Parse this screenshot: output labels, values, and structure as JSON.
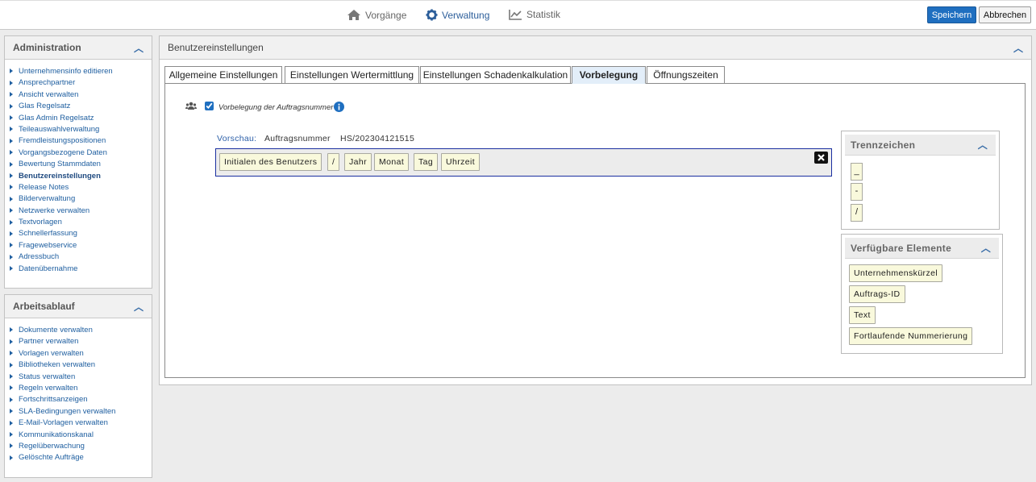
{
  "topnav": {
    "vorgaenge": "Vorgänge",
    "verwaltung": "Verwaltung",
    "statistik": "Statistik",
    "speichern": "Speichern",
    "abbrechen": "Abbrechen"
  },
  "sidebar": {
    "admin_title": "Administration",
    "admin_items": [
      "Unternehmensinfo editieren",
      "Ansprechpartner",
      "Ansicht verwalten",
      "Glas Regelsatz",
      "Glas Admin Regelsatz",
      "Teileauswahlverwaltung",
      "Fremdleistungspositionen",
      "Vorgangsbezogene Daten",
      "Bewertung Stammdaten",
      "Benutzereinstellungen",
      "Release Notes",
      "Bilderverwaltung",
      "Netzwerke verwalten",
      "Textvorlagen",
      "Schnellerfassung",
      "Fragewebservice",
      "Adressbuch",
      "Datenübernahme"
    ],
    "workflow_title": "Arbeitsablauf",
    "workflow_items": [
      "Dokumente verwalten",
      "Partner verwalten",
      "Vorlagen verwalten",
      "Bibliotheken verwalten",
      "Status verwalten",
      "Regeln verwalten",
      "Fortschrittsanzeigen",
      "SLA-Bedingungen verwalten",
      "E-Mail-Vorlagen verwalten",
      "Kommunikationskanal",
      "Regelüberwachung",
      "Gelöschte Aufträge"
    ]
  },
  "main": {
    "title": "Benutzereinstellungen",
    "tabs": [
      "Allgemeine Einstellungen",
      "Einstellungen Wertermittlung",
      "Einstellungen Schadenkalkulation",
      "Vorbelegung",
      "Öffnungszeiten"
    ],
    "checkbox_label": "Vorbelegung der Auftragsnummer",
    "preview_label": "Vorschau:",
    "preview_field": "Auftragsnummer",
    "preview_value": "HS/202304121515",
    "sequence": [
      "Initialen des Benutzers",
      "/",
      "Jahr",
      "Monat",
      "Tag",
      "Uhrzeit"
    ],
    "trenn_title": "Trennzeichen",
    "trenn_items": [
      "_",
      "-",
      "/"
    ],
    "verf_title": "Verfügbare Elemente",
    "verf_items": [
      "Unternehmenskürzel",
      "Auftrags-ID",
      "Text",
      "Fortlaufende Nummerierung"
    ]
  }
}
